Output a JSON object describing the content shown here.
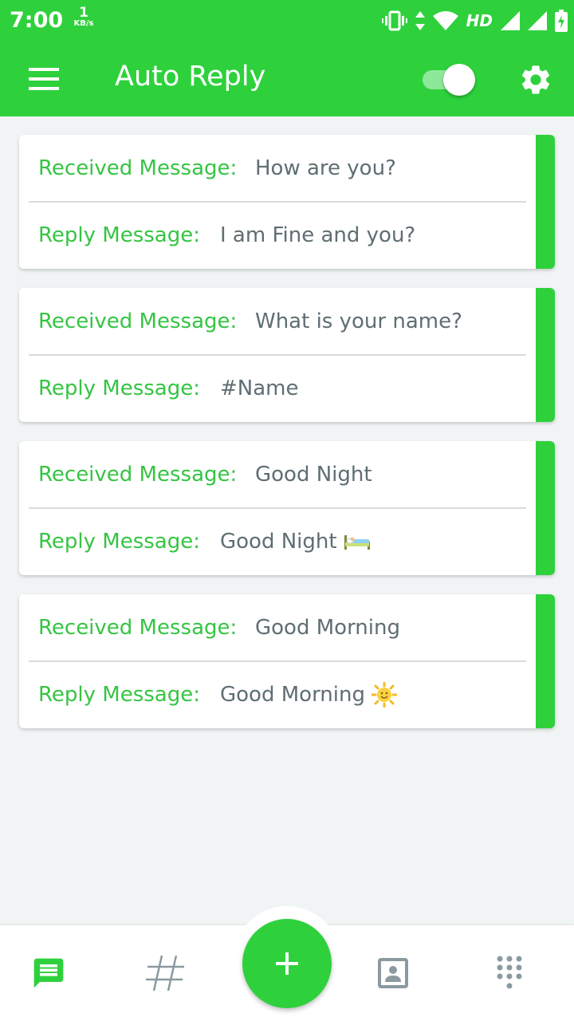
{
  "status_bar": {
    "time": "7:00",
    "speed_value": "1",
    "speed_unit": "KB/s",
    "network_label": "HD",
    "icons": [
      "vibrate-icon",
      "data-arrows-icon",
      "wifi-icon",
      "signal-icon",
      "signal-icon",
      "battery-charging-icon"
    ]
  },
  "app_bar": {
    "title": "Auto Reply",
    "toggle_on": true,
    "icons": [
      "menu-icon",
      "gear-icon"
    ]
  },
  "messages": [
    {
      "received_label": "Received Message:",
      "received": "How are you?",
      "reply_label": "Reply Message:",
      "reply": "I am Fine and you?",
      "reply_icon": ""
    },
    {
      "received_label": "Received Message:",
      "received": "What is your name?",
      "reply_label": "Reply Message:",
      "reply": "#Name",
      "reply_icon": ""
    },
    {
      "received_label": "Received Message:",
      "received": "Good Night",
      "reply_label": "Reply Message:",
      "reply": "Good Night",
      "reply_icon": "bed-emoji-icon"
    },
    {
      "received_label": "Received Message:",
      "received": "Good Morning",
      "reply_label": "Reply Message:",
      "reply": "Good Morning",
      "reply_icon": "sun-emoji-icon"
    }
  ],
  "bottom_nav": {
    "items": [
      "messages-icon",
      "hashtag-icon",
      "add-icon",
      "contact-icon",
      "dialpad-icon"
    ],
    "active": "messages-icon"
  },
  "colors": {
    "primary": "#2ed13c",
    "label_green": "#36c443",
    "value_text": "#5f6e72",
    "background": "#f1f4f5",
    "inactive_icon": "#8a9aa0"
  }
}
